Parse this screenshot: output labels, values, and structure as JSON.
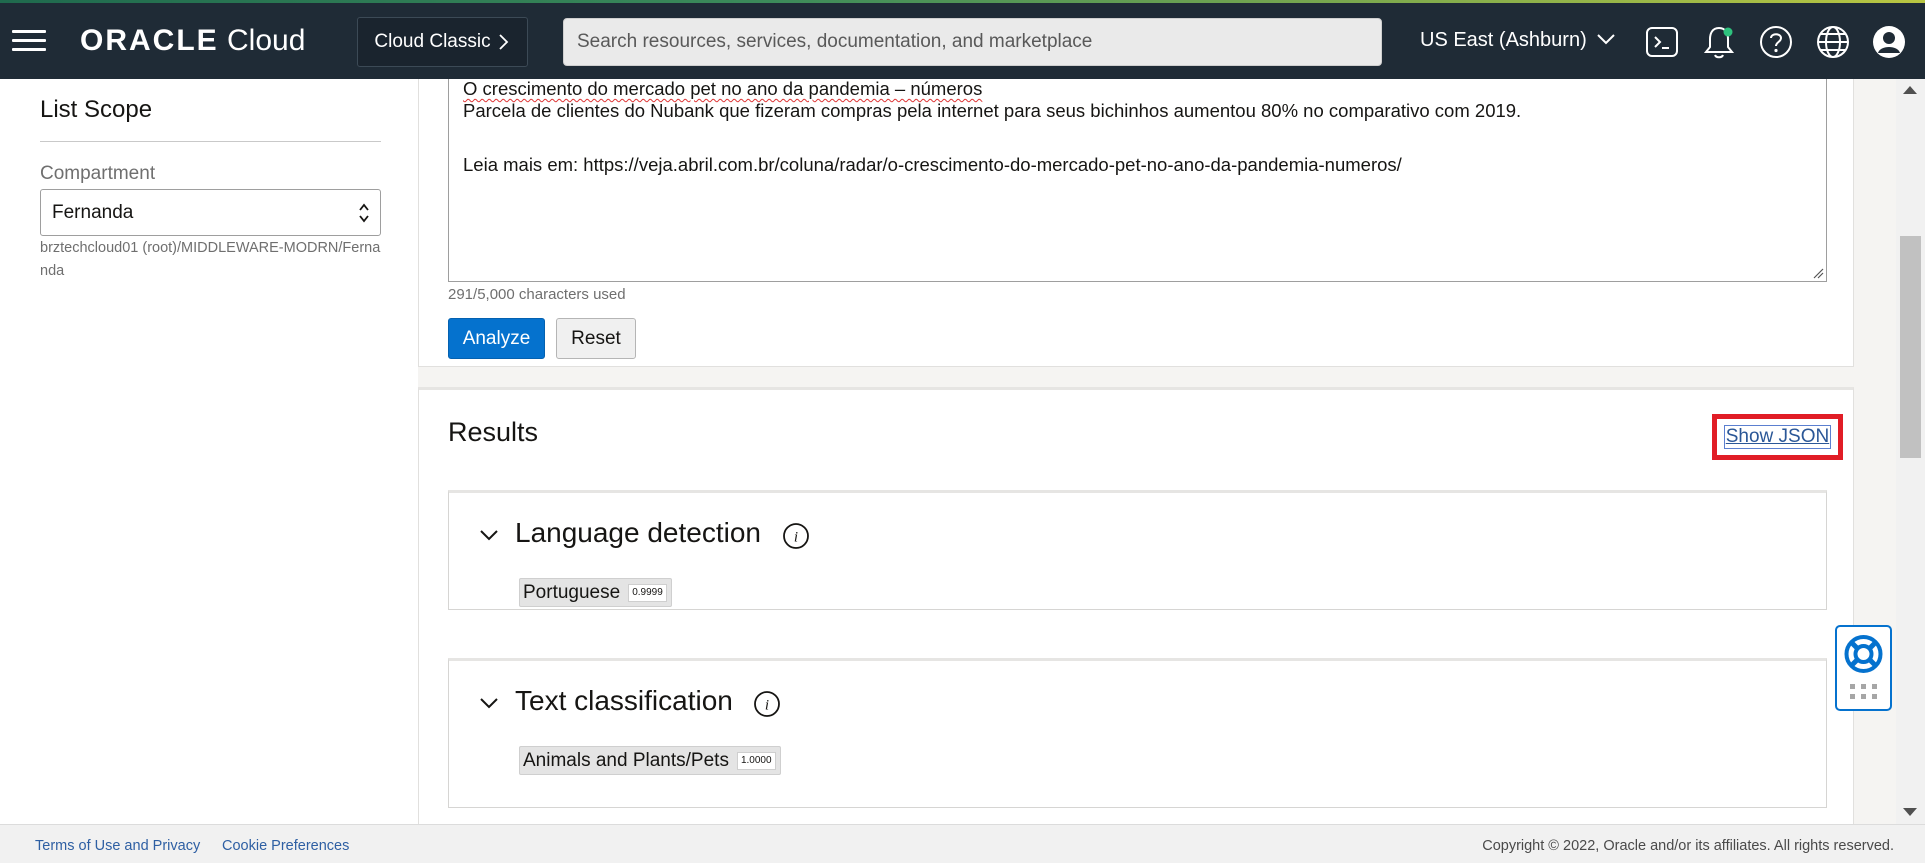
{
  "header": {
    "logo_brand": "ORACLE",
    "logo_product": "Cloud",
    "cloud_classic_label": "Cloud Classic",
    "search_placeholder": "Search resources, services, documentation, and marketplace",
    "region_label": "US East (Ashburn)",
    "icons": [
      "hamburger-menu-icon",
      "cloud-shell-icon",
      "notifications-bell-icon",
      "help-question-icon",
      "language-globe-icon",
      "user-profile-icon"
    ]
  },
  "sidebar": {
    "title": "List Scope",
    "compartment_label": "Compartment",
    "compartment_value": "Fernanda",
    "compartment_path": "brztechcloud01 (root)/MIDDLEWARE-MODRN/Fernanda"
  },
  "input": {
    "line1": "O crescimento do mercado pet no ano da pandemia – números",
    "line2": "Parcela de clientes do Nubank que fizeram compras pela internet para seus bichinhos aumentou 80% no comparativo com 2019.",
    "line3": "Leia mais em: https://veja.abril.com.br/coluna/radar/o-crescimento-do-mercado-pet-no-ano-da-pandemia-numeros/",
    "char_count": "291/5,000 characters used",
    "analyze_label": "Analyze",
    "reset_label": "Reset"
  },
  "results": {
    "title": "Results",
    "show_json_label": "Show JSON",
    "language_detection": {
      "title": "Language detection",
      "tag_label": "Portuguese",
      "tag_score": "0.9999"
    },
    "text_classification": {
      "title": "Text classification",
      "tag_label": "Animals and Plants/Pets",
      "tag_score": "1.0000"
    }
  },
  "footer": {
    "terms_label": "Terms of Use and Privacy",
    "cookie_label": "Cookie Preferences",
    "copyright": "Copyright © 2022, Oracle and/or its affiliates. All rights reserved."
  },
  "colors": {
    "header_bg": "#1f2b36",
    "primary_button": "#0572ce",
    "highlight_box": "#e11d26",
    "link": "#2e5fa3"
  }
}
